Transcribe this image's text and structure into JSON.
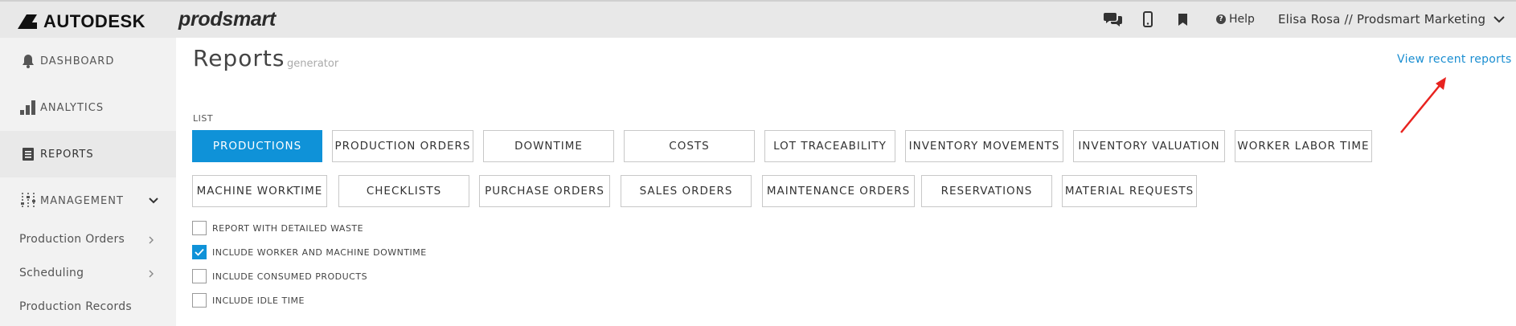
{
  "topbar": {
    "brand": "AUTODESK",
    "product": "prodsmart",
    "help_label": "Help",
    "user_label": "Elisa Rosa // Prodsmart Marketing"
  },
  "sidebar": {
    "items": [
      {
        "label": "DASHBOARD",
        "icon": "bell-icon"
      },
      {
        "label": "ANALYTICS",
        "icon": "bar-chart-icon"
      },
      {
        "label": "REPORTS",
        "icon": "report-icon"
      },
      {
        "label": "MANAGEMENT",
        "icon": "sliders-icon"
      }
    ],
    "sub_items": [
      {
        "label": "Production Orders"
      },
      {
        "label": "Scheduling"
      },
      {
        "label": "Production Records"
      }
    ]
  },
  "main": {
    "title": "Reports",
    "subtitle": "generator",
    "recent_link": "View recent reports",
    "list_label": "LIST",
    "report_buttons_row1": [
      "PRODUCTIONS",
      "PRODUCTION ORDERS",
      "DOWNTIME",
      "COSTS",
      "LOT TRACEABILITY",
      "INVENTORY MOVEMENTS",
      "INVENTORY VALUATION",
      "WORKER LABOR TIME"
    ],
    "report_buttons_row2": [
      "MACHINE WORKTIME",
      "CHECKLISTS",
      "PURCHASE ORDERS",
      "SALES ORDERS",
      "MAINTENANCE ORDERS",
      "RESERVATIONS",
      "MATERIAL REQUESTS"
    ],
    "selected_report": "PRODUCTIONS",
    "options": [
      {
        "label": "REPORT WITH DETAILED WASTE",
        "checked": false
      },
      {
        "label": "INCLUDE WORKER AND MACHINE DOWNTIME",
        "checked": true
      },
      {
        "label": "INCLUDE CONSUMED PRODUCTS",
        "checked": false
      },
      {
        "label": "INCLUDE IDLE TIME",
        "checked": false
      }
    ]
  },
  "colors": {
    "accent": "#0f92d8",
    "link": "#1a8ed1",
    "annotation_arrow": "#e8231f",
    "topbar_bg": "#e8e8e8",
    "sidebar_bg": "#f2f2f2"
  }
}
